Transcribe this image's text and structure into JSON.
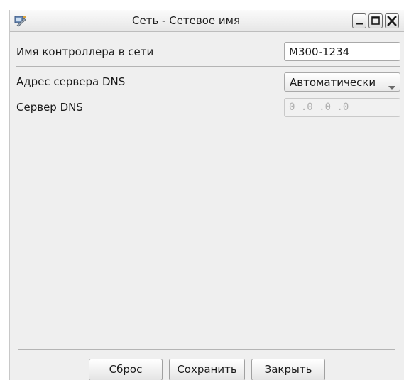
{
  "window": {
    "title": "Сеть - Сетевое имя",
    "icon": "network-settings-icon",
    "controls": {
      "minimize_icon": "minimize-icon",
      "maximize_icon": "maximize-icon",
      "close_icon": "close-icon"
    }
  },
  "form": {
    "controller_name": {
      "label": "Имя контроллера в сети",
      "value": "M300-1234"
    },
    "dns_address": {
      "label": "Адрес сервера DNS",
      "selected": "Автоматически"
    },
    "dns_server": {
      "label": "Сервер DNS",
      "value": "0 .0 .0 .0"
    }
  },
  "buttons": {
    "reset": "Сброс",
    "save": "Сохранить",
    "close": "Закрыть"
  },
  "colors": {
    "window_bg": "#efefef",
    "disabled_text": "#b0b0b0"
  }
}
